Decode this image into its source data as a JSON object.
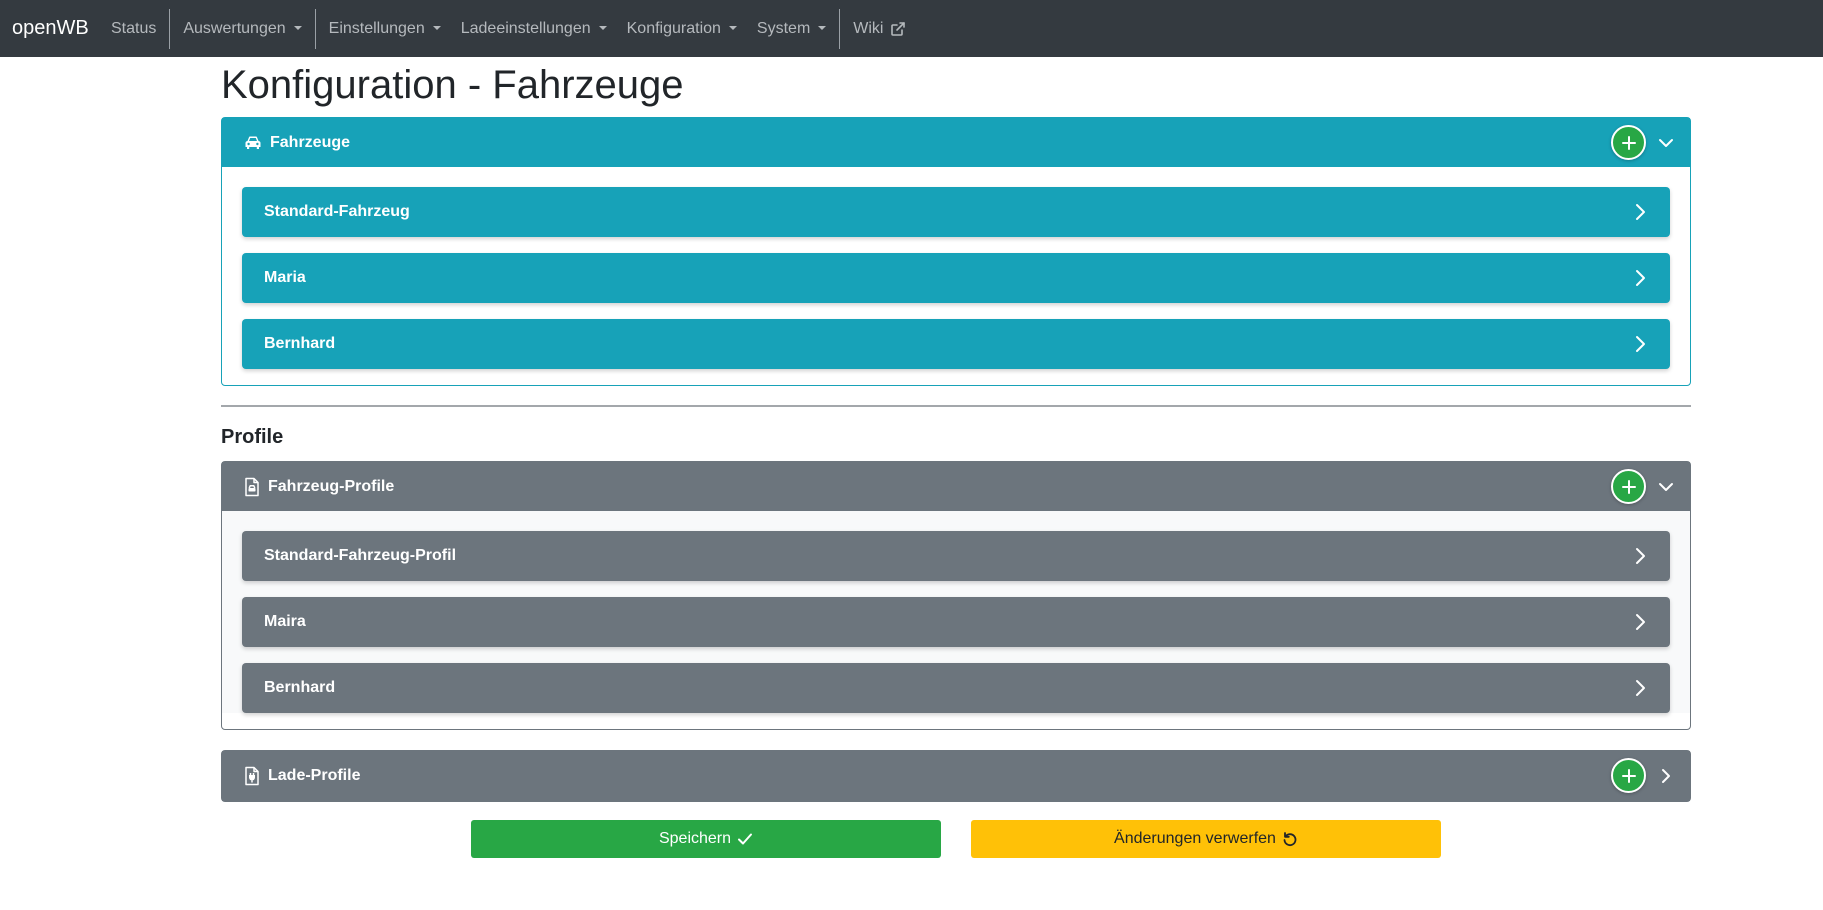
{
  "navbar": {
    "brand": "openWB",
    "items": [
      {
        "label": "Status"
      },
      {
        "label": "Auswertungen"
      },
      {
        "label": "Einstellungen"
      },
      {
        "label": "Ladeeinstellungen"
      },
      {
        "label": "Konfiguration"
      },
      {
        "label": "System"
      },
      {
        "label": "Wiki"
      }
    ]
  },
  "page": {
    "title": "Konfiguration - Fahrzeuge"
  },
  "vehicles": {
    "header": "Fahrzeuge",
    "items": [
      {
        "label": "Standard-Fahrzeug"
      },
      {
        "label": "Maria"
      },
      {
        "label": "Bernhard"
      }
    ]
  },
  "profiles": {
    "section_title": "Profile",
    "vehicle_profiles": {
      "header": "Fahrzeug-Profile",
      "items": [
        {
          "label": "Standard-Fahrzeug-Profil"
        },
        {
          "label": "Maira"
        },
        {
          "label": "Bernhard"
        }
      ]
    },
    "charge_profiles": {
      "header": "Lade-Profile"
    }
  },
  "actions": {
    "save_label": "Speichern",
    "discard_label": "Änderungen verwerfen"
  },
  "colors": {
    "navbar": "#343a40",
    "teal": "#17a2b8",
    "gray": "#6c757d",
    "success": "#28a745",
    "warning": "#ffc107"
  },
  "icons": [
    "car-icon",
    "file-car-icon",
    "file-plug-icon",
    "plus-icon",
    "chevron-down-icon",
    "chevron-right-icon",
    "external-link-icon",
    "check-icon",
    "undo-icon"
  ]
}
